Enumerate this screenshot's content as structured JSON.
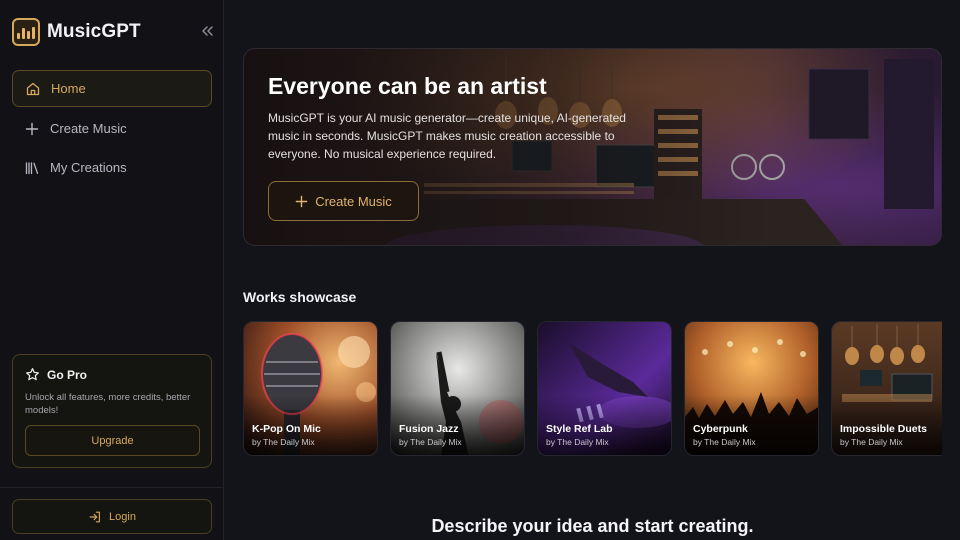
{
  "app": {
    "name": "MusicGPT"
  },
  "sidebar": {
    "items": [
      {
        "label": "Home",
        "icon": "home-icon",
        "active": true
      },
      {
        "label": "Create Music",
        "icon": "plus-icon",
        "active": false
      },
      {
        "label": "My Creations",
        "icon": "library-icon",
        "active": false
      }
    ],
    "gopro": {
      "title": "Go Pro",
      "description": "Unlock all features, more credits, better models!",
      "button": "Upgrade"
    },
    "login": "Login"
  },
  "hero": {
    "title": "Everyone can be an artist",
    "description": "MusicGPT is your AI music generator—create unique, AI-generated music in seconds. MusicGPT makes music creation accessible to everyone. No musical experience required.",
    "button": "Create Music"
  },
  "showcase": {
    "title": "Works showcase",
    "cards": [
      {
        "title": "K-Pop On Mic",
        "author": "by The Daily Mix"
      },
      {
        "title": "Fusion Jazz",
        "author": "by The Daily Mix"
      },
      {
        "title": "Style Ref Lab",
        "author": "by The Daily Mix"
      },
      {
        "title": "Cyberpunk",
        "author": "by The Daily Mix"
      },
      {
        "title": "Impossible Duets",
        "author": "by The Daily Mix"
      }
    ]
  },
  "prompt": {
    "title": "Describe your idea and start creating."
  },
  "colors": {
    "accent": "#d6a95e",
    "background": "#13131a",
    "sidebar": "#121216"
  }
}
